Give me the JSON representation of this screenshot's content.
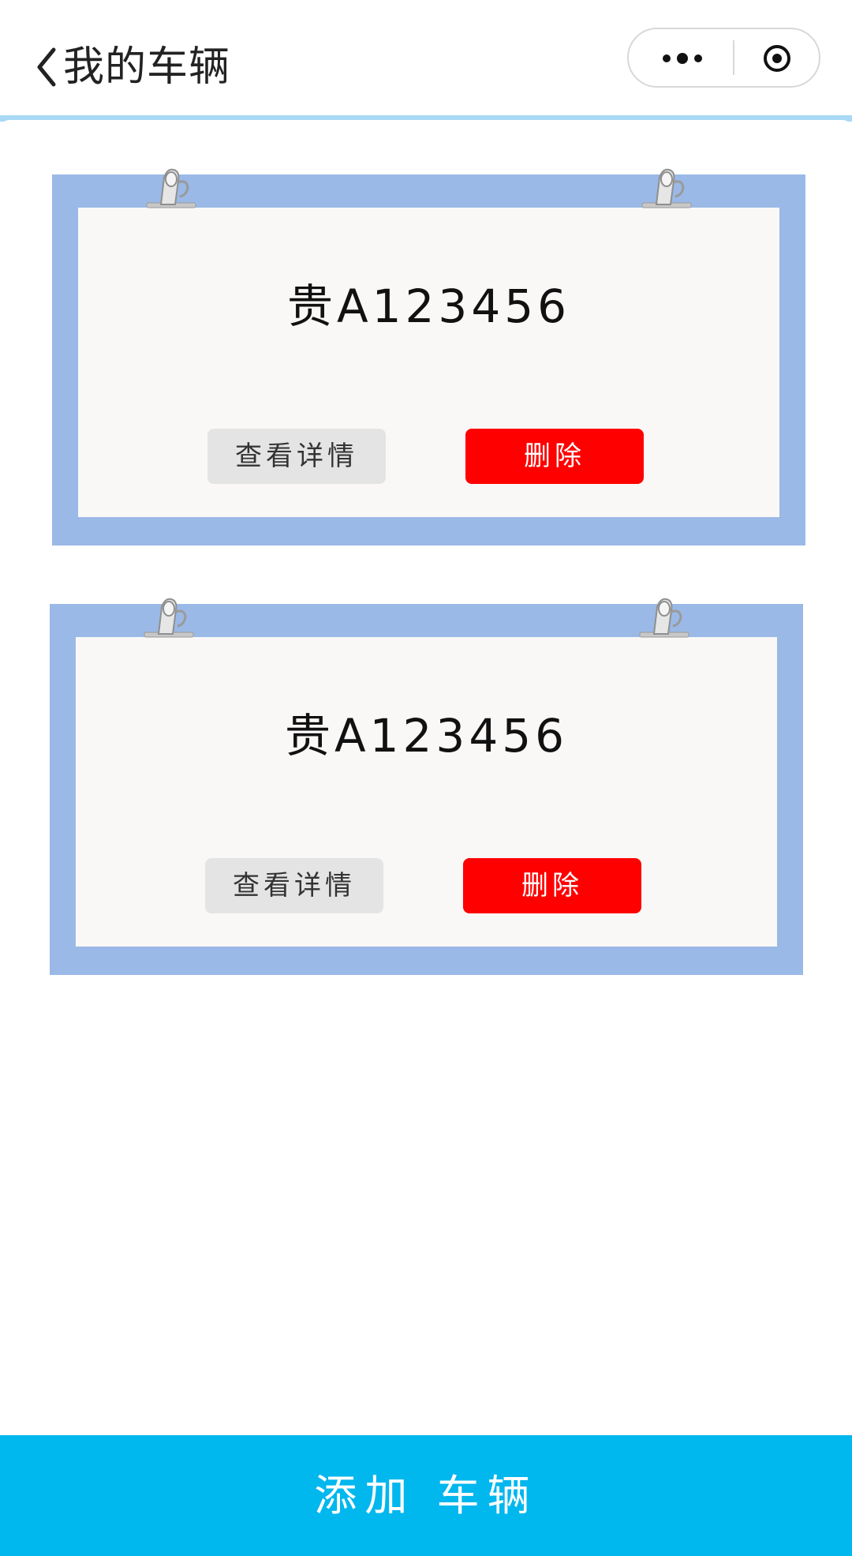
{
  "header": {
    "title": "我的车辆",
    "back_icon": "chevron-left-icon",
    "more_icon": "more-dots-icon",
    "close_icon": "target-circle-icon"
  },
  "vehicles": [
    {
      "plate": "贵A123456",
      "detail_label": "查看详情",
      "delete_label": "删除"
    },
    {
      "plate": "贵A123456",
      "detail_label": "查看详情",
      "delete_label": "删除"
    }
  ],
  "footer": {
    "add_label": "添加 车辆"
  },
  "colors": {
    "accent_blue": "#00b7ee",
    "card_frame": "#9ab9e6",
    "paper": "#faf8f7",
    "delete_red": "#ff0000",
    "detail_gray": "#e4e4e4",
    "header_line": "#a9d9f4"
  }
}
